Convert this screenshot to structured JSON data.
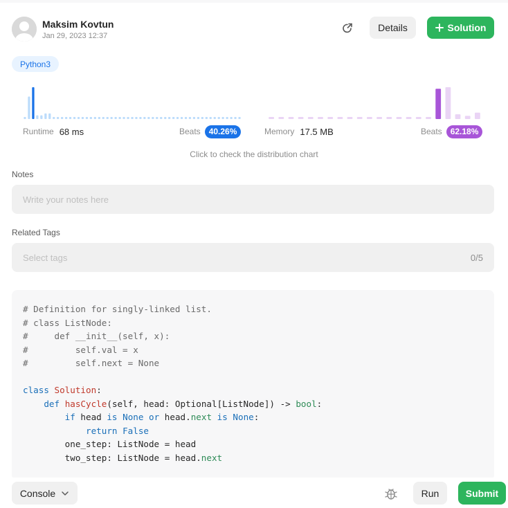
{
  "submission": {
    "author": "Maksim Kovtun",
    "date": "Jan 29, 2023 12:37",
    "details_label": "Details",
    "solution_label": "Solution",
    "language": "Python3"
  },
  "stats": {
    "runtime_label": "Runtime",
    "runtime_value": "68 ms",
    "runtime_beats_label": "Beats",
    "runtime_beats": "40.26%",
    "memory_label": "Memory",
    "memory_value": "17.5 MB",
    "memory_beats_label": "Beats",
    "memory_beats": "62.18%",
    "distribution_link": "Click to check the distribution chart"
  },
  "notes": {
    "label": "Notes",
    "placeholder": "Write your notes here"
  },
  "tags": {
    "label": "Related Tags",
    "placeholder": "Select tags",
    "count": "0/5"
  },
  "code_lines": [
    "# Definition for singly-linked list.",
    "# class ListNode:",
    "#     def __init__(self, x):",
    "#         self.val = x",
    "#         self.next = None",
    "",
    "class Solution:",
    "    def hasCycle(self, head: Optional[ListNode]) -> bool:",
    "        if head is None or head.next is None:",
    "            return False",
    "        one_step: ListNode = head",
    "        two_step: ListNode = head.next"
  ],
  "bottom_bar": {
    "console_label": "Console",
    "run_label": "Run",
    "submit_label": "Submit"
  },
  "colors": {
    "accent_green": "#2db55d",
    "runtime_blue": "#1a73e8",
    "memory_purple": "#a855d8"
  },
  "icons": [
    "avatar-icon",
    "share-icon",
    "plus-icon",
    "chevron-down-icon",
    "bug-icon"
  ],
  "chart_data": [
    {
      "type": "bar",
      "series": [
        {
          "values": [
            1,
            12,
            17,
            2,
            2,
            3,
            3,
            1,
            1,
            1,
            1,
            1,
            1,
            1,
            1,
            1,
            1,
            1,
            1,
            1,
            1,
            1,
            1,
            1,
            1,
            1,
            1,
            1,
            1,
            1,
            1,
            1,
            1,
            1,
            1,
            1,
            1,
            1,
            1,
            1,
            1,
            1,
            1,
            1,
            1,
            1,
            1,
            1,
            1,
            1,
            1,
            1,
            1
          ]
        }
      ],
      "highlight_index": 2
    },
    {
      "type": "bar",
      "series": [
        {
          "values": [
            1,
            1,
            1,
            1,
            1,
            1,
            1,
            1,
            1,
            1,
            1,
            1,
            1,
            1,
            1,
            1,
            1,
            19,
            20,
            3,
            2,
            4
          ]
        }
      ],
      "highlight_index": 17
    }
  ]
}
